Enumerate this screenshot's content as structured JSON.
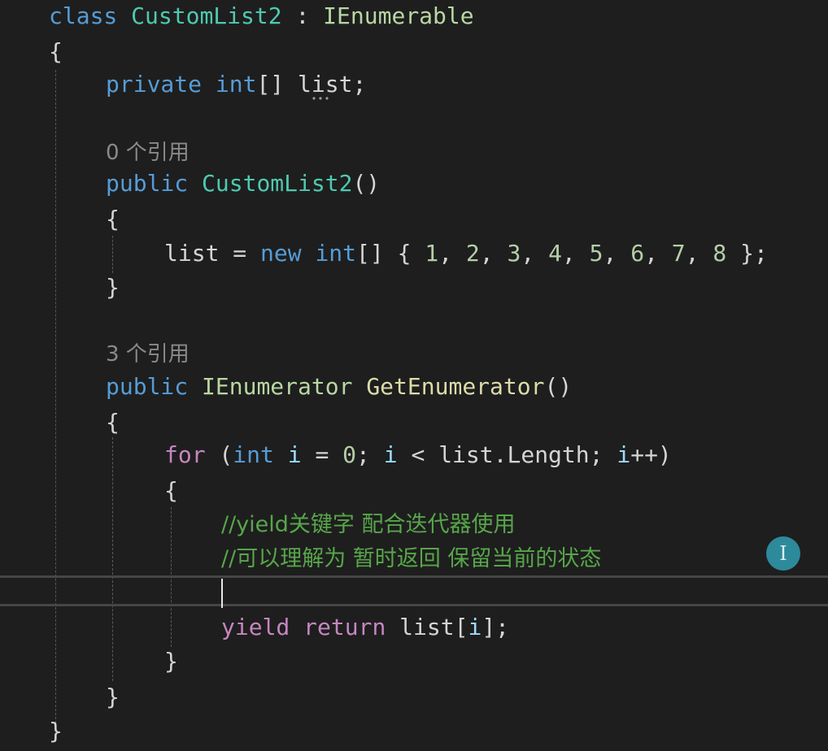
{
  "code": {
    "class_line": {
      "kw_class": "class",
      "class_name": "CustomList2",
      "colon": " : ",
      "base": "IEnumerable"
    },
    "open_brace_1": "{",
    "field_line": {
      "kw_private": "private",
      "kw_int": "int",
      "brackets": "[] ",
      "name": "list",
      "semi": ";"
    },
    "lens_ctor": "0 个引用",
    "ctor_sig": {
      "kw_public": "public",
      "name": "CustomList2",
      "parens": "()"
    },
    "ctor_open": "{",
    "ctor_body": {
      "lhs": "list",
      "eq": " = ",
      "kw_new": "new",
      "kw_int": "int",
      "brackets": "[] { ",
      "values": [
        "1",
        "2",
        "3",
        "4",
        "5",
        "6",
        "7",
        "8"
      ],
      "close": " };"
    },
    "ctor_close": "}",
    "lens_get": "3 个引用",
    "get_sig": {
      "kw_public": "public",
      "ret_type": "IEnumerator",
      "name": "GetEnumerator",
      "parens": "()"
    },
    "get_open": "{",
    "for_line": {
      "kw_for": "for",
      "open": " (",
      "kw_int": "int",
      "var_i": "i",
      "init": " = ",
      "zero": "0",
      "semi": "; ",
      "var_i2": "i",
      "lt": " < ",
      "list": "list",
      "dot_len": ".Length",
      "semi2": "; ",
      "var_i3": "i",
      "inc": "++)"
    },
    "for_open": "{",
    "comment1": "//yield关键字 配合迭代器使用",
    "comment2": "//可以理解为 暂时返回 保留当前的状态",
    "yield_line": {
      "kw_yield": "yield",
      "kw_return": "return",
      "list": "list",
      "idx_open": "[",
      "var_i": "i",
      "idx_close": "];"
    },
    "for_close": "}",
    "get_close": "}",
    "class_close": "}"
  },
  "cursor_icon": "text-cursor-icon",
  "colors": {
    "background": "#1e1e1e",
    "keyword": "#569cd6",
    "type": "#4ec9b0",
    "comment": "#57a64a",
    "number": "#b5cea8",
    "control": "#c586c0"
  }
}
